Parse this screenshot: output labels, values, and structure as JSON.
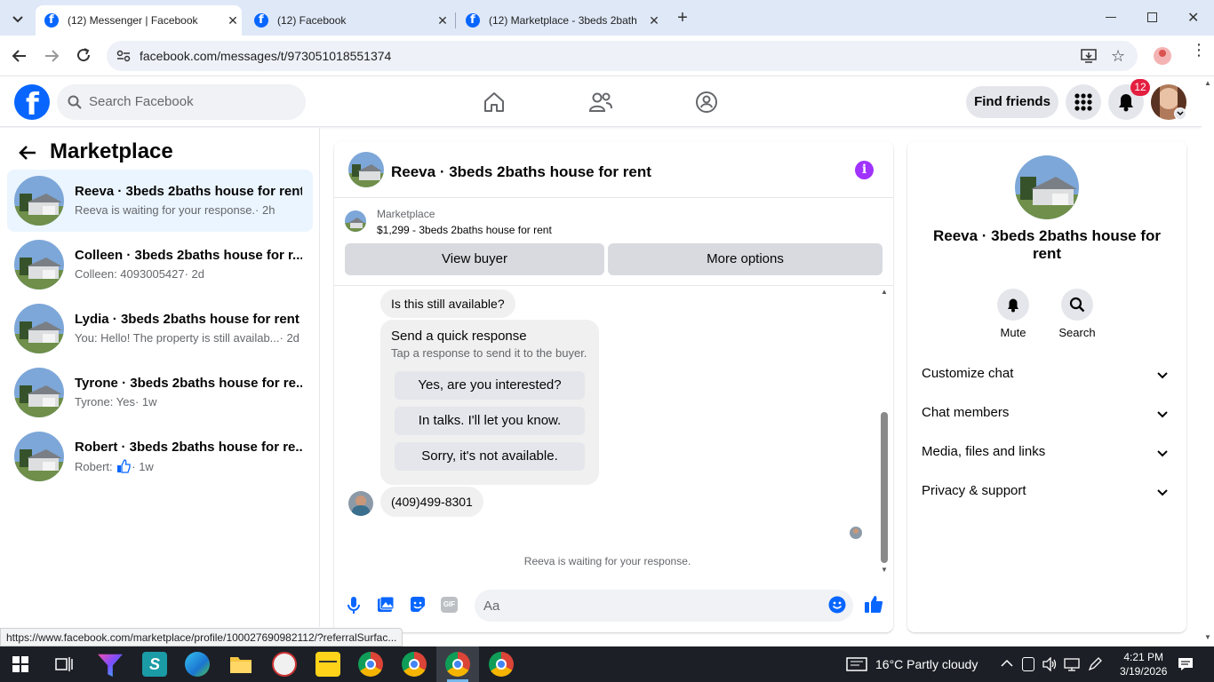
{
  "browser": {
    "tabs": [
      {
        "title": "(12) Messenger | Facebook",
        "active": true
      },
      {
        "title": "(12) Facebook",
        "active": false
      },
      {
        "title": "(12) Marketplace - 3beds 2bath",
        "active": false
      }
    ],
    "url": "facebook.com/messages/t/973051018551374",
    "status_url": "https://www.facebook.com/marketplace/profile/100027690982112/?referralSurfac..."
  },
  "fb_header": {
    "search_placeholder": "Search Facebook",
    "find_friends": "Find friends",
    "notification_count": "12",
    "brand_color": "#0866ff"
  },
  "left_panel": {
    "title": "Marketplace",
    "conversations": [
      {
        "name": "Reeva · 3beds 2baths house for rent",
        "preview": "Reeva is waiting for your response.",
        "time": "· 2h",
        "selected": true
      },
      {
        "name": "Colleen · 3beds 2baths house for r...",
        "preview": "Colleen: 4093005427",
        "time": "· 2d",
        "selected": false
      },
      {
        "name": "Lydia · 3beds 2baths house for rent",
        "preview": "You: Hello! The property is still availab...",
        "time": "· 2d",
        "selected": false
      },
      {
        "name": "Tyrone · 3beds 2baths house for re...",
        "preview": "Tyrone: Yes",
        "time": "· 1w",
        "selected": false
      },
      {
        "name": "Robert · 3beds 2baths house for re...",
        "preview": "Robert:",
        "time": "· 1w",
        "selected": false
      }
    ]
  },
  "chat": {
    "title": "Reeva · 3beds 2baths house for rent",
    "marketplace_label": "Marketplace",
    "listing": "$1,299 - 3beds 2baths house for rent",
    "view_buyer": "View buyer",
    "more_options": "More options",
    "messages": {
      "first": "Is this still available?",
      "quick_title": "Send a quick response",
      "quick_sub": "Tap a response to send it to the buyer.",
      "quick_replies": [
        "Yes, are you interested?",
        "In talks. I'll let you know.",
        "Sorry, it's not available."
      ],
      "phone": "(409)499-8301"
    },
    "waiting": "Reeva is waiting for your response.",
    "input_placeholder": "Aa",
    "accent": "#0866ff",
    "info_color": "#a033ff"
  },
  "right_panel": {
    "name": "Reeva · 3beds 2baths house for rent",
    "actions": [
      {
        "label": "Mute",
        "icon": "bell-icon"
      },
      {
        "label": "Search",
        "icon": "search-icon"
      }
    ],
    "sections": [
      "Customize chat",
      "Chat members",
      "Media, files and links",
      "Privacy & support"
    ]
  },
  "taskbar": {
    "weather": "16°C  Partly cloudy",
    "time": "4:21 PM",
    "date": "3/19/2026"
  }
}
